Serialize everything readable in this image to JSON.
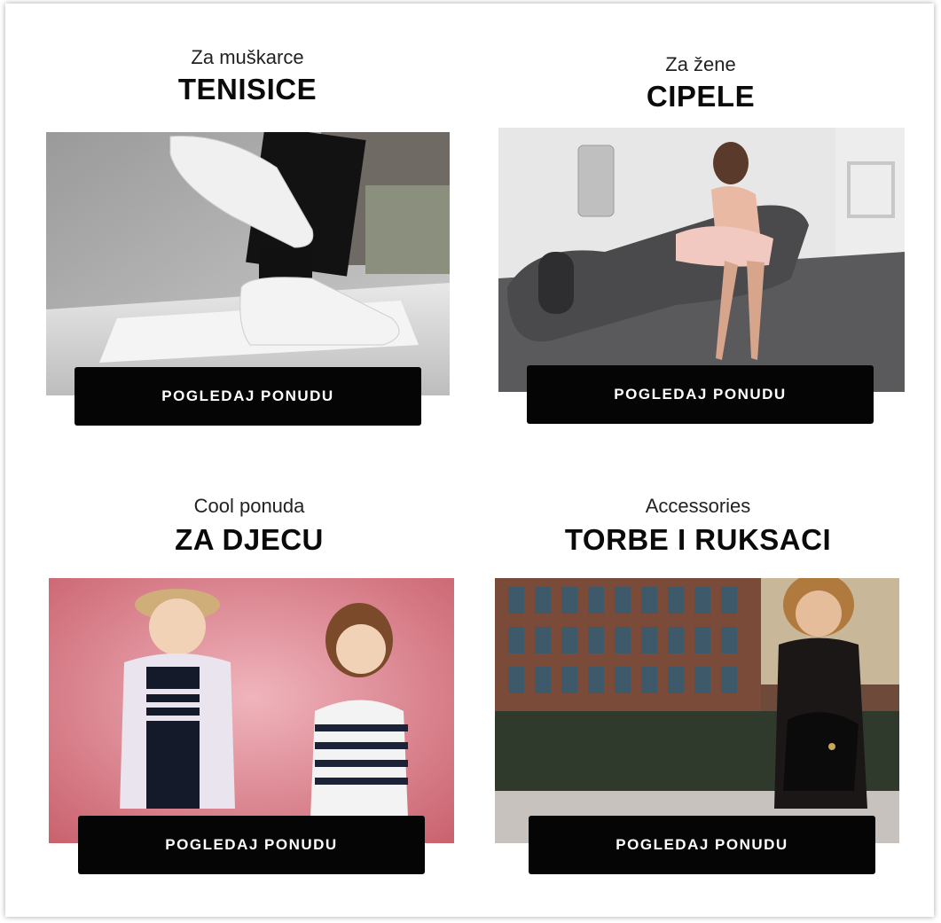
{
  "cards": [
    {
      "subtitle": "Za muškarce",
      "title": "TENISICE",
      "button_label": "POGLEDAJ PONUDU"
    },
    {
      "subtitle": "Za žene",
      "title": "CIPELE",
      "button_label": "POGLEDAJ PONUDU"
    },
    {
      "subtitle": "Cool ponuda",
      "title": "ZA DJECU",
      "button_label": "POGLEDAJ PONUDU"
    },
    {
      "subtitle": "Accessories",
      "title": "TORBE I RUKSACI",
      "button_label": "POGLEDAJ PONUDU"
    }
  ]
}
